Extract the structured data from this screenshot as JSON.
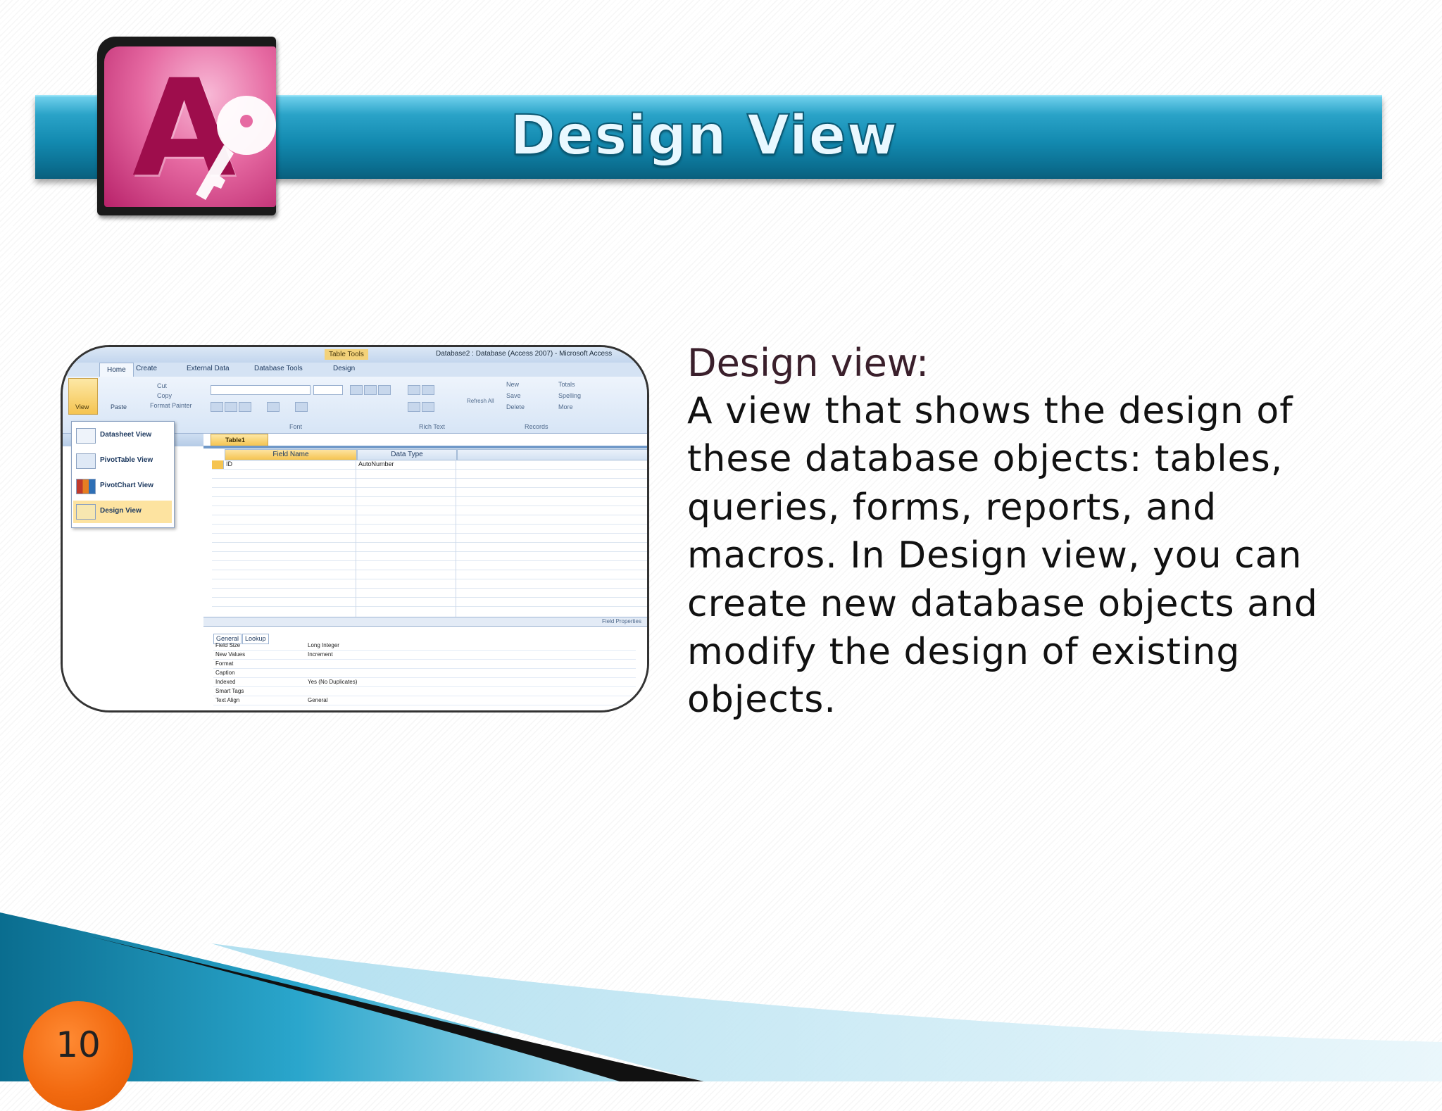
{
  "slide": {
    "title": "Design View",
    "heading": "Design view:",
    "body": "A view that shows the design of these database objects: tables, queries, forms, reports, and macros. In Design view, you can create new database objects and modify the design of existing objects.",
    "slide_number": "10",
    "logo_letter": "A"
  },
  "screenshot": {
    "context_tab": "Table Tools",
    "window_title": "Database2 : Database (Access 2007) - Microsoft Access",
    "tabs": [
      "Home",
      "Create",
      "External Data",
      "Database Tools",
      "Design"
    ],
    "ribbon_view_label": "View",
    "ribbon_paste_label": "Paste",
    "clipboard_items": [
      "Cut",
      "Copy",
      "Format Painter"
    ],
    "group_labels": [
      "Font",
      "Rich Text",
      "Records"
    ],
    "records_items": [
      "New",
      "Save",
      "Delete",
      "Totals",
      "Spelling",
      "More"
    ],
    "refresh_label": "Refresh All",
    "view_menu": [
      "Datasheet View",
      "PivotTable View",
      "PivotChart View",
      "Design View"
    ],
    "doc_tab": "Table1",
    "columns": {
      "field_name": "Field Name",
      "data_type": "Data Type"
    },
    "first_row": {
      "field": "ID",
      "type": "AutoNumber"
    },
    "field_properties_label": "Field Properties",
    "property_tabs": [
      "General",
      "Lookup"
    ],
    "properties": [
      {
        "name": "Field Size",
        "value": "Long Integer"
      },
      {
        "name": "New Values",
        "value": "Increment"
      },
      {
        "name": "Format",
        "value": ""
      },
      {
        "name": "Caption",
        "value": ""
      },
      {
        "name": "Indexed",
        "value": "Yes (No Duplicates)"
      },
      {
        "name": "Smart Tags",
        "value": ""
      },
      {
        "name": "Text Align",
        "value": "General"
      }
    ]
  },
  "colors": {
    "banner": "#138ab0",
    "slide_number_circle": "#f26a10",
    "logo_pink": "#e66aa2",
    "heading": "#3a1f2b"
  },
  "icons": [
    "access-logo-icon",
    "key-icon"
  ]
}
